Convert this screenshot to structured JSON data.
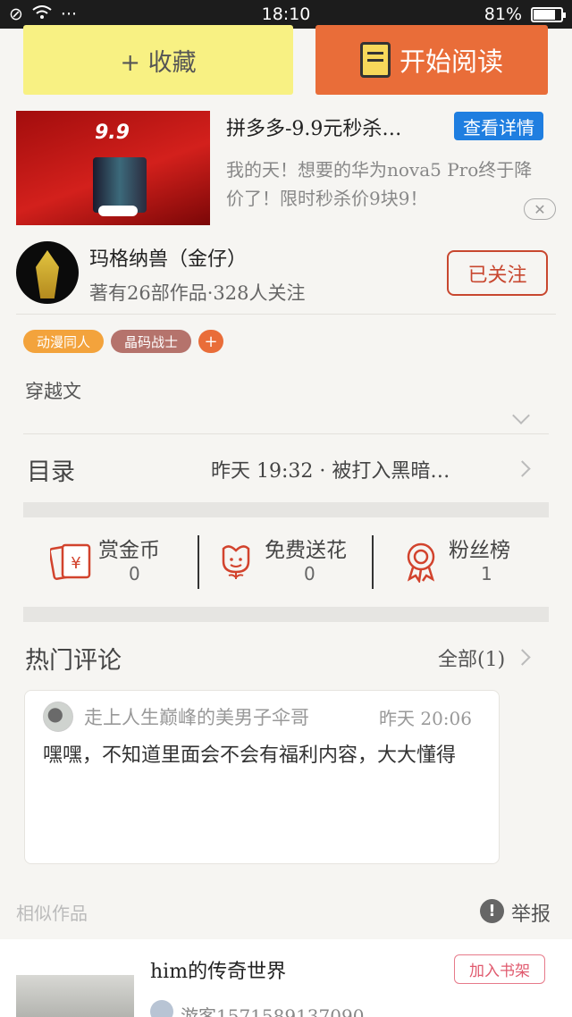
{
  "status_bar": {
    "time": "18:10",
    "battery": "81%",
    "battery_level": 0.81,
    "dots": "···"
  },
  "top_actions": {
    "favorite_label": "+ 收藏",
    "read_label": "开始阅读"
  },
  "ad": {
    "image_text": "9.9",
    "title": "拼多多-9.9元秒杀…",
    "detail_button": "查看详情",
    "description": "我的天！想要的华为nova5 Pro终于降价了！限时秒杀价9块9！",
    "close_icon": "close-icon"
  },
  "author": {
    "name": "玛格纳兽（金仔）",
    "stats": "著有26部作品·328人关注",
    "follow_label": "已关注"
  },
  "tags": [
    "动漫同人",
    "晶码战士"
  ],
  "tag_add": "+",
  "genre": "穿越文",
  "catalog": {
    "label": "目录",
    "latest": "昨天 19:32 · 被打入黑暗…"
  },
  "actions": [
    {
      "label": "赏金币",
      "count": "0",
      "icon": "red-envelope-icon"
    },
    {
      "label": "免费送花",
      "count": "0",
      "icon": "flower-icon"
    },
    {
      "label": "粉丝榜",
      "count": "1",
      "icon": "medal-icon"
    }
  ],
  "comments": {
    "title": "热门评论",
    "all_link": "全部(1)",
    "items": [
      {
        "user": "走上人生巅峰的美男子伞哥",
        "time": "昨天 20:06",
        "text": "嘿嘿，不知道里面会不会有福利内容，大大懂得"
      }
    ]
  },
  "similar": {
    "label": "相似作品",
    "report_label": "举报"
  },
  "similar_book": {
    "title": "him的传奇世界",
    "add_label": "加入书架",
    "author": "游客1571589137090"
  }
}
